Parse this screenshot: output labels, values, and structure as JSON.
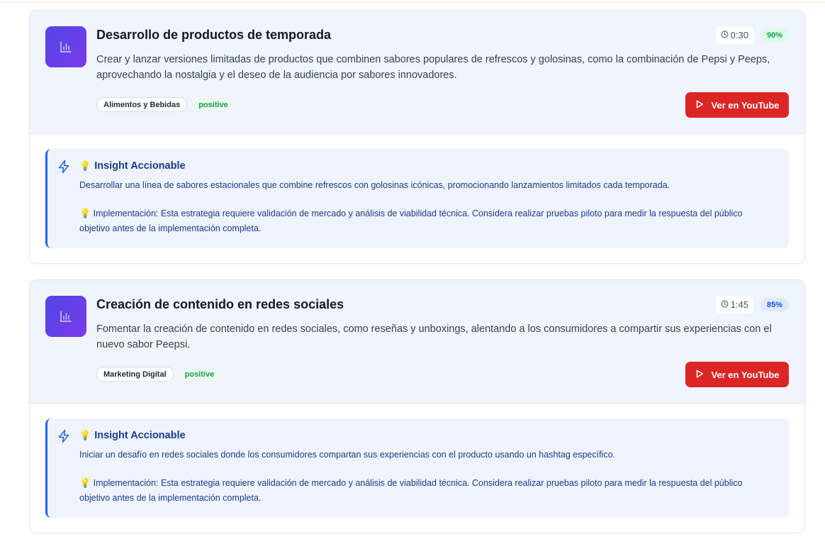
{
  "cards": [
    {
      "title": "Desarrollo de productos de temporada",
      "time": "0:30",
      "score": "90%",
      "score_color": "#16a34a",
      "score_bg": "#dcfce7",
      "description": "Crear y lanzar versiones limitadas de productos que combinen sabores populares de refrescos y golosinas, como la combinación de Pepsi y Peeps, aprovechando la nostalgia y el deseo de la audiencia por sabores innovadores.",
      "category": "Alimentos y Bebidas",
      "sentiment": "positive",
      "youtube_label": "Ver en YouTube",
      "insight_title": "Insight Accionable",
      "insight_text": "Desarrollar una línea de sabores estacionales que combine refrescos con golosinas icónicas, promocionando lanzamientos limitados cada temporada.",
      "implementation": "Implementación: Esta estrategia requiere validación de mercado y análisis de viabilidad técnica. Considera realizar pruebas piloto para medir la respuesta del público objetivo antes de la implementación completa."
    },
    {
      "title": "Creación de contenido en redes sociales",
      "time": "1:45",
      "score": "85%",
      "score_color": "#1d4ed8",
      "score_bg": "#dbeafe",
      "description": "Fomentar la creación de contenido en redes sociales, como reseñas y unboxings, alentando a los consumidores a compartir sus experiencias con el nuevo sabor Peepsi.",
      "category": "Marketing Digital",
      "sentiment": "positive",
      "youtube_label": "Ver en YouTube",
      "insight_title": "Insight Accionable",
      "insight_text": "Iniciar un desafío en redes sociales donde los consumidores compartan sus experiencias con el producto usando un hashtag específico.",
      "implementation": "Implementación: Esta estrategia requiere validación de mercado y análisis de viabilidad técnica. Considera realizar pruebas piloto para medir la respuesta del público objetivo antes de la implementación completa."
    }
  ],
  "icons": {
    "logo": "bar-chart-icon",
    "time": "clock-icon",
    "youtube": "play-icon",
    "insight": "zap-icon",
    "bulb": "lightbulb-icon"
  },
  "colors": {
    "accent": "#2563eb",
    "youtube_red": "#dc2626",
    "logo_gradient_start": "#4f46e5",
    "logo_gradient_end": "#7c3aed"
  }
}
